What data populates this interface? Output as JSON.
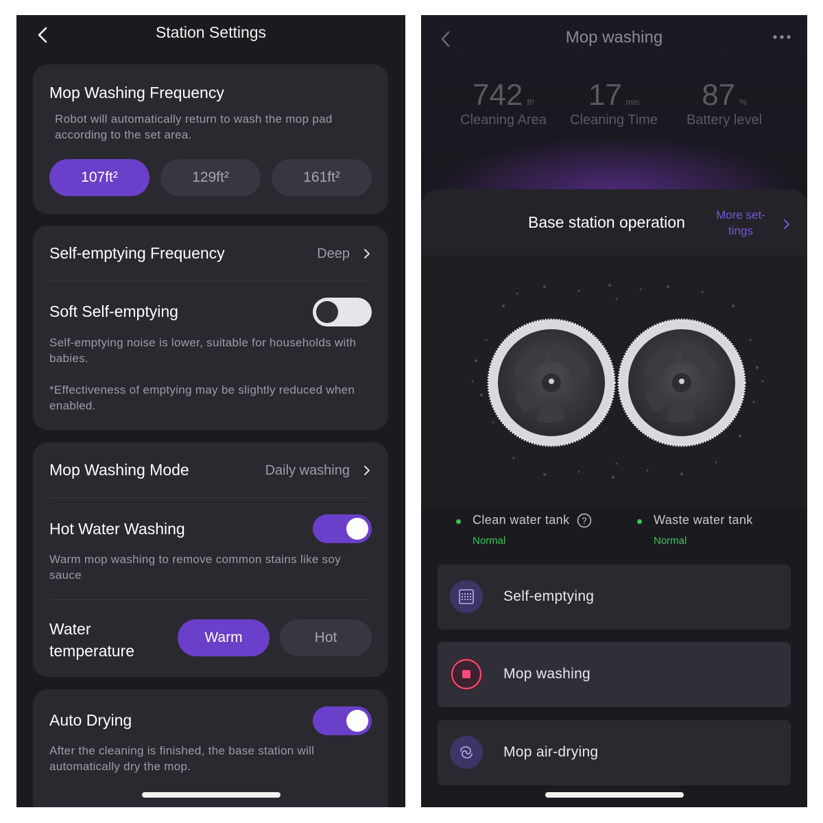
{
  "left": {
    "title": "Station Settings",
    "mop_washing_frequency": {
      "title": "Mop Washing Frequency",
      "description": "Robot will automatically return to wash the mop pad according to the set area.",
      "options": [
        "107ft²",
        "129ft²",
        "161ft²"
      ],
      "selected": "107ft²"
    },
    "self_emptying_frequency": {
      "label": "Self-emptying Frequency",
      "value": "Deep"
    },
    "soft_self_emptying": {
      "label": "Soft Self-emptying",
      "enabled": false,
      "description": "Self-emptying noise is lower, suitable for households with babies.",
      "note": "*Effectiveness of emptying may be slightly reduced when enabled."
    },
    "mop_washing_mode": {
      "label": "Mop Washing Mode",
      "value": "Daily washing"
    },
    "hot_water_washing": {
      "label": "Hot Water Washing",
      "enabled": true,
      "description": "Warm mop washing to remove common stains like soy sauce"
    },
    "water_temperature": {
      "label_line1": "Water",
      "label_line2": "temperature",
      "options": [
        "Warm",
        "Hot"
      ],
      "selected": "Warm"
    },
    "auto_drying": {
      "label": "Auto Drying",
      "enabled": true,
      "description": "After the cleaning is finished, the base station will automatically dry the mop."
    }
  },
  "right": {
    "title": "Mop washing",
    "stats": [
      {
        "value": "742",
        "unit": "ft²",
        "label": "Cleaning Area"
      },
      {
        "value": "17",
        "unit": "min",
        "label": "Cleaning Time"
      },
      {
        "value": "87",
        "unit": "%",
        "label": "Battery level"
      }
    ],
    "operation_title": "Base station operation",
    "more_settings_line1": "More set-",
    "more_settings_line2": "tings",
    "tanks": [
      {
        "name": "Clean water tank",
        "status": "Normal"
      },
      {
        "name": "Waste water tank",
        "status": "Normal"
      }
    ],
    "actions": [
      {
        "label": "Self-emptying",
        "icon": "dustbin-icon"
      },
      {
        "label": "Mop washing",
        "icon": "mop-washing-icon",
        "active": true
      },
      {
        "label": "Mop air-drying",
        "icon": "air-drying-icon"
      }
    ]
  },
  "colors": {
    "accent": "#6a3fc9",
    "link": "#7a52e0",
    "status_ok": "#36c457",
    "background": "#1b1b1f",
    "card": "#2a2930"
  }
}
